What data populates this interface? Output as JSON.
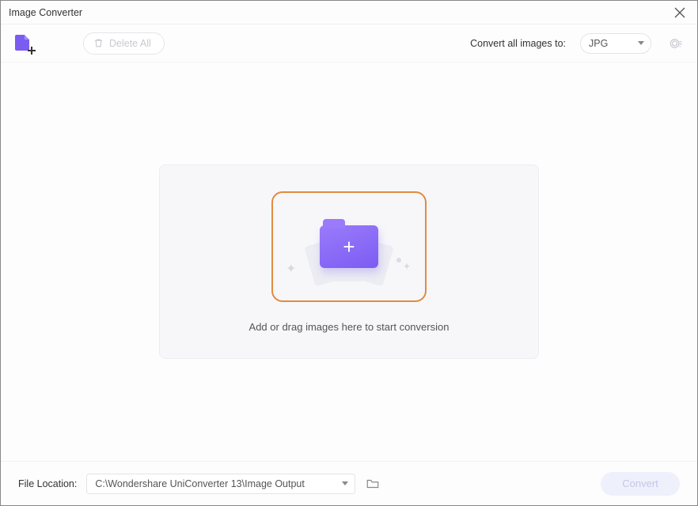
{
  "window": {
    "title": "Image Converter"
  },
  "toolbar": {
    "delete_all_label": "Delete All",
    "convert_to_label": "Convert all images to:",
    "format_selected": "JPG"
  },
  "dropzone": {
    "hint": "Add or drag images here to start conversion"
  },
  "footer": {
    "location_label": "File Location:",
    "location_path": "C:\\Wondershare UniConverter 13\\Image Output",
    "convert_label": "Convert"
  }
}
